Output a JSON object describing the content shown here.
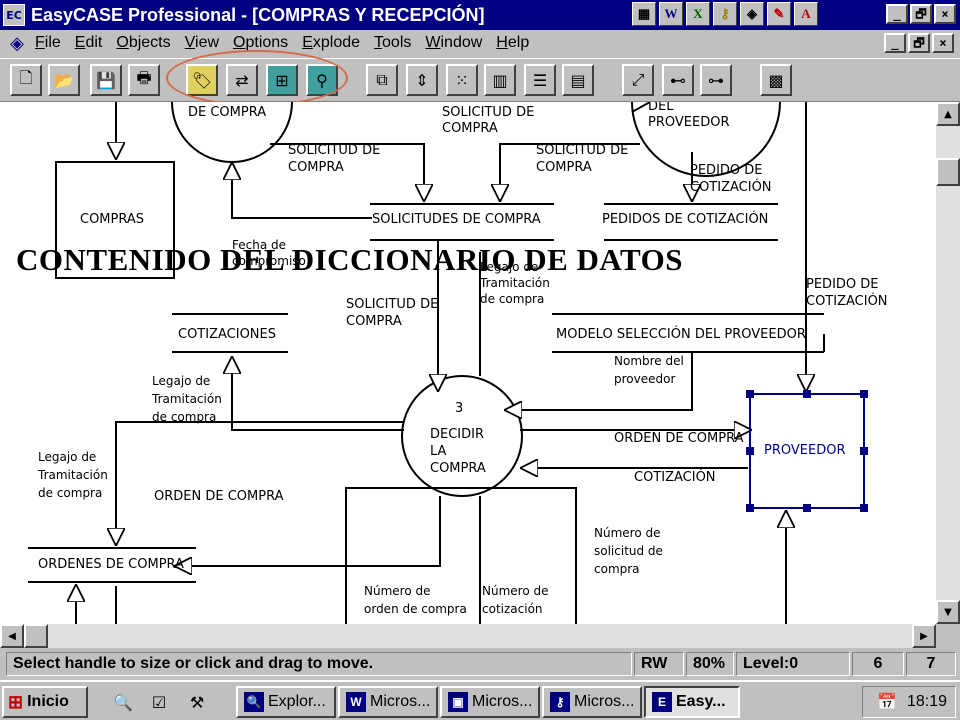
{
  "window": {
    "app_icon": "easycase-app-icon",
    "title": "EasyCASE Professional - [COMPRAS Y RECEPCIÓN]",
    "controls": {
      "minimize": "_",
      "restore": "🗗",
      "close": "×"
    }
  },
  "title_tray_icons": [
    {
      "icon": "windows-icon",
      "glyph": "▦"
    },
    {
      "icon": "word-icon",
      "glyph": "W"
    },
    {
      "icon": "excel-icon",
      "glyph": "X"
    },
    {
      "icon": "key-icon",
      "glyph": "⚷"
    },
    {
      "icon": "app-icon",
      "glyph": "◈"
    },
    {
      "icon": "pen-icon",
      "glyph": "✎"
    },
    {
      "icon": "acrobat-icon",
      "glyph": "A"
    }
  ],
  "menu": {
    "items": [
      "File",
      "Edit",
      "Objects",
      "View",
      "Options",
      "Explode",
      "Tools",
      "Window",
      "Help"
    ]
  },
  "toolbar": {
    "buttons": [
      {
        "icon": "new-file-icon",
        "glyph": "🗋"
      },
      {
        "icon": "open-folder-icon",
        "glyph": "📂"
      },
      {
        "icon": "save-icon",
        "glyph": "💾"
      },
      {
        "icon": "print-icon",
        "glyph": "🖶"
      },
      {
        "icon": "data-dictionary-icon",
        "glyph": "🏷"
      },
      {
        "icon": "flow-icon",
        "glyph": "⇄"
      },
      {
        "icon": "process-chart-icon",
        "glyph": "⊞"
      },
      {
        "icon": "search-diagram-icon",
        "glyph": "⚲"
      },
      {
        "icon": "window-icon",
        "glyph": "⧉"
      },
      {
        "icon": "scroll-updown-icon",
        "glyph": "⇕"
      },
      {
        "icon": "grid-icon",
        "glyph": "⁙"
      },
      {
        "icon": "ruler-icon",
        "glyph": "▥"
      },
      {
        "icon": "list-icon",
        "glyph": "☰"
      },
      {
        "icon": "table-icon",
        "glyph": "▤"
      },
      {
        "icon": "expand-icon",
        "glyph": "⤢"
      },
      {
        "icon": "hierarchy-icon",
        "glyph": "⊷"
      },
      {
        "icon": "tree-icon",
        "glyph": "⊶"
      },
      {
        "icon": "pattern-icon",
        "glyph": "▩"
      }
    ]
  },
  "diagram": {
    "overlay_title": "CONTENIDO DEL DICCIONARIO DE DATOS",
    "labels": {
      "de_compra": "DE COMPRA",
      "proveedor_partial_1": "DEL",
      "proveedor_partial_2": "PROVEEDOR",
      "solicitud_top_1": "SOLICITUD DE",
      "solicitud_top_2": "COMPRA",
      "solicitud_left_1": "SOLICITUD DE",
      "solicitud_left_2": "COMPRA",
      "solicitud_mid_1": "SOLICITUD DE",
      "solicitud_mid_2": "COMPRA",
      "pedido_cot_1_a": "PEDIDO DE",
      "pedido_cot_1_b": "COTIZACIÓN",
      "compras_entity": "COMPRAS",
      "store_solicitudes": "SOLICITUDES DE COMPRA",
      "store_pedidos": "PEDIDOS DE COTIZACIÓN",
      "fecha_1": "Fecha de",
      "fecha_2": "compromiso",
      "legajo_top_1": "Legajo de",
      "legajo_top_2": "Tramitación",
      "legajo_top_3": "de compra",
      "pedido_cot_2_a": "PEDIDO DE",
      "pedido_cot_2_b": "COTIZACIÓN",
      "solicitud_center_1": "SOLICITUD DE",
      "solicitud_center_2": "COMPRA",
      "store_cotizaciones": "COTIZACIONES",
      "store_modelo": "MODELO SELECCIÓN DEL PROVEEDOR",
      "nombre_1": "Nombre del",
      "nombre_2": "proveedor",
      "legajo_left_1": "Legajo de",
      "legajo_left_2": "Tramitación",
      "legajo_left_3": "de compra",
      "process_number": "3",
      "process_1": "DECIDIR",
      "process_2": "LA",
      "process_3": "COMPRA",
      "orden_right": "ORDEN DE COMPRA",
      "proveedor_entity": "PROVEEDOR",
      "cotizacion": "COTIZACIÓN",
      "legajo_far_1": "Legajo de",
      "legajo_far_2": "Tramitación",
      "legajo_far_3": "de compra",
      "orden_left": "ORDEN DE COMPRA",
      "num_sol_1": "Número de",
      "num_sol_2": "solicitud de",
      "num_sol_3": "compra",
      "store_ordenes": "ORDENES DE COMPRA",
      "num_orden_1": "Número de",
      "num_orden_2": "orden de compra",
      "num_cot_1": "Número de",
      "num_cot_2": "cotización"
    }
  },
  "statusbar": {
    "message": "Select handle to size or click and drag to move.",
    "mode": "RW",
    "zoom": "80%",
    "level": "Level:0",
    "field_a": "6",
    "field_b": "7"
  },
  "taskbar": {
    "start_label": "Inicio",
    "quick_launch": [
      {
        "icon": "explorer-icon",
        "glyph": "🔍"
      },
      {
        "icon": "checklist-icon",
        "glyph": "☑"
      },
      {
        "icon": "tools-icon",
        "glyph": "⚒"
      }
    ],
    "tasks": [
      {
        "label": "Explor...",
        "icon": "🔍",
        "active": false
      },
      {
        "label": "Micros...",
        "icon": "W",
        "active": false
      },
      {
        "label": "Micros...",
        "icon": "▣",
        "active": false
      },
      {
        "label": "Micros...",
        "icon": "⚷",
        "active": false
      },
      {
        "label": "Easy...",
        "icon": "E",
        "active": true
      }
    ],
    "clock": "18:19"
  }
}
